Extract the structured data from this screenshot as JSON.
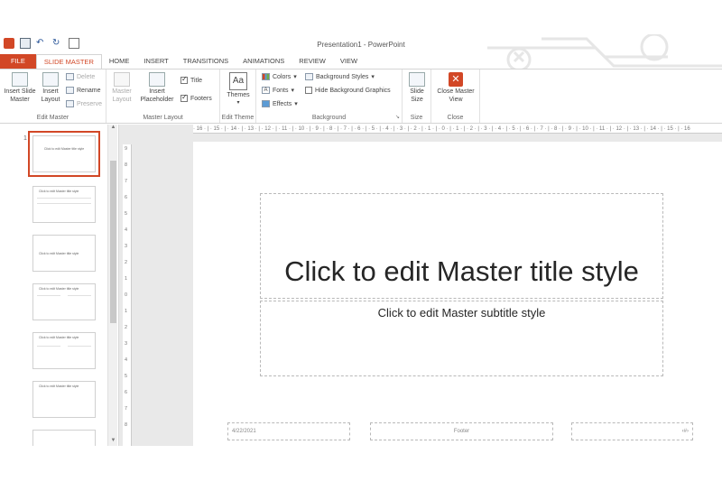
{
  "window": {
    "title": "Presentation1 - PowerPoint"
  },
  "tabs": [
    "FILE",
    "SLIDE MASTER",
    "HOME",
    "INSERT",
    "TRANSITIONS",
    "ANIMATIONS",
    "REVIEW",
    "VIEW"
  ],
  "ribbon": {
    "edit_master": {
      "label": "Edit Master",
      "insert_slide_master": "Insert Slide Master",
      "insert_layout": "Insert Layout",
      "delete": "Delete",
      "rename": "Rename",
      "preserve": "Preserve"
    },
    "master_layout": {
      "label": "Master Layout",
      "master_layout_btn": "Master Layout",
      "insert_placeholder": "Insert Placeholder",
      "title_check": "Title",
      "footers_check": "Footers",
      "title_checked": true,
      "footers_checked": true
    },
    "edit_theme": {
      "label": "Edit Theme",
      "themes": "Themes"
    },
    "background": {
      "label": "Background",
      "colors": "Colors",
      "fonts": "Fonts",
      "effects": "Effects",
      "background_styles": "Background Styles",
      "hide_background_graphics": "Hide Background Graphics"
    },
    "size": {
      "label": "Size",
      "slide_size": "Slide Size"
    },
    "close": {
      "label": "Close",
      "close_master_view": "Close Master View"
    }
  },
  "thumbnails": [
    {
      "number": "1",
      "title": "Click to edit Master title style",
      "selected": true
    },
    {
      "number": "",
      "title": "Click to edit Master title style",
      "selected": false
    },
    {
      "number": "",
      "title": "Click to edit Master title style",
      "selected": false
    },
    {
      "number": "",
      "title": "Click to edit Master title style",
      "selected": false
    },
    {
      "number": "",
      "title": "Click to edit Master title style",
      "selected": false
    },
    {
      "number": "",
      "title": "Click to edit Master title style",
      "selected": false
    }
  ],
  "ruler": {
    "horizontal": "· 16 · | · 15 · | · 14 · | · 13 · | · 12 · | · 11 · | · 10 · | · 9 · | · 8 · | · 7 · | · 6 · | · 5 · | · 4 · | · 3 · | · 2 · | · 1 · | · 0 · | · 1 · | · 2 · | · 3 · | · 4 · | · 5 · | · 6 · | · 7 · | · 8 · | · 9 · | · 10 · | · 11 · | · 12 · | · 13 · | · 14 · | · 15 · | · 16",
    "vertical": [
      "9",
      "8",
      "7",
      "6",
      "5",
      "4",
      "3",
      "2",
      "1",
      "0",
      "1",
      "2",
      "3",
      "4",
      "5",
      "6",
      "7",
      "8"
    ]
  },
  "slide": {
    "title": "Click to edit Master title style",
    "subtitle": "Click to edit Master subtitle style",
    "date": "4/22/2021",
    "footer": "Footer",
    "number": "‹#›"
  },
  "colors": {
    "accent": "#d24726"
  }
}
